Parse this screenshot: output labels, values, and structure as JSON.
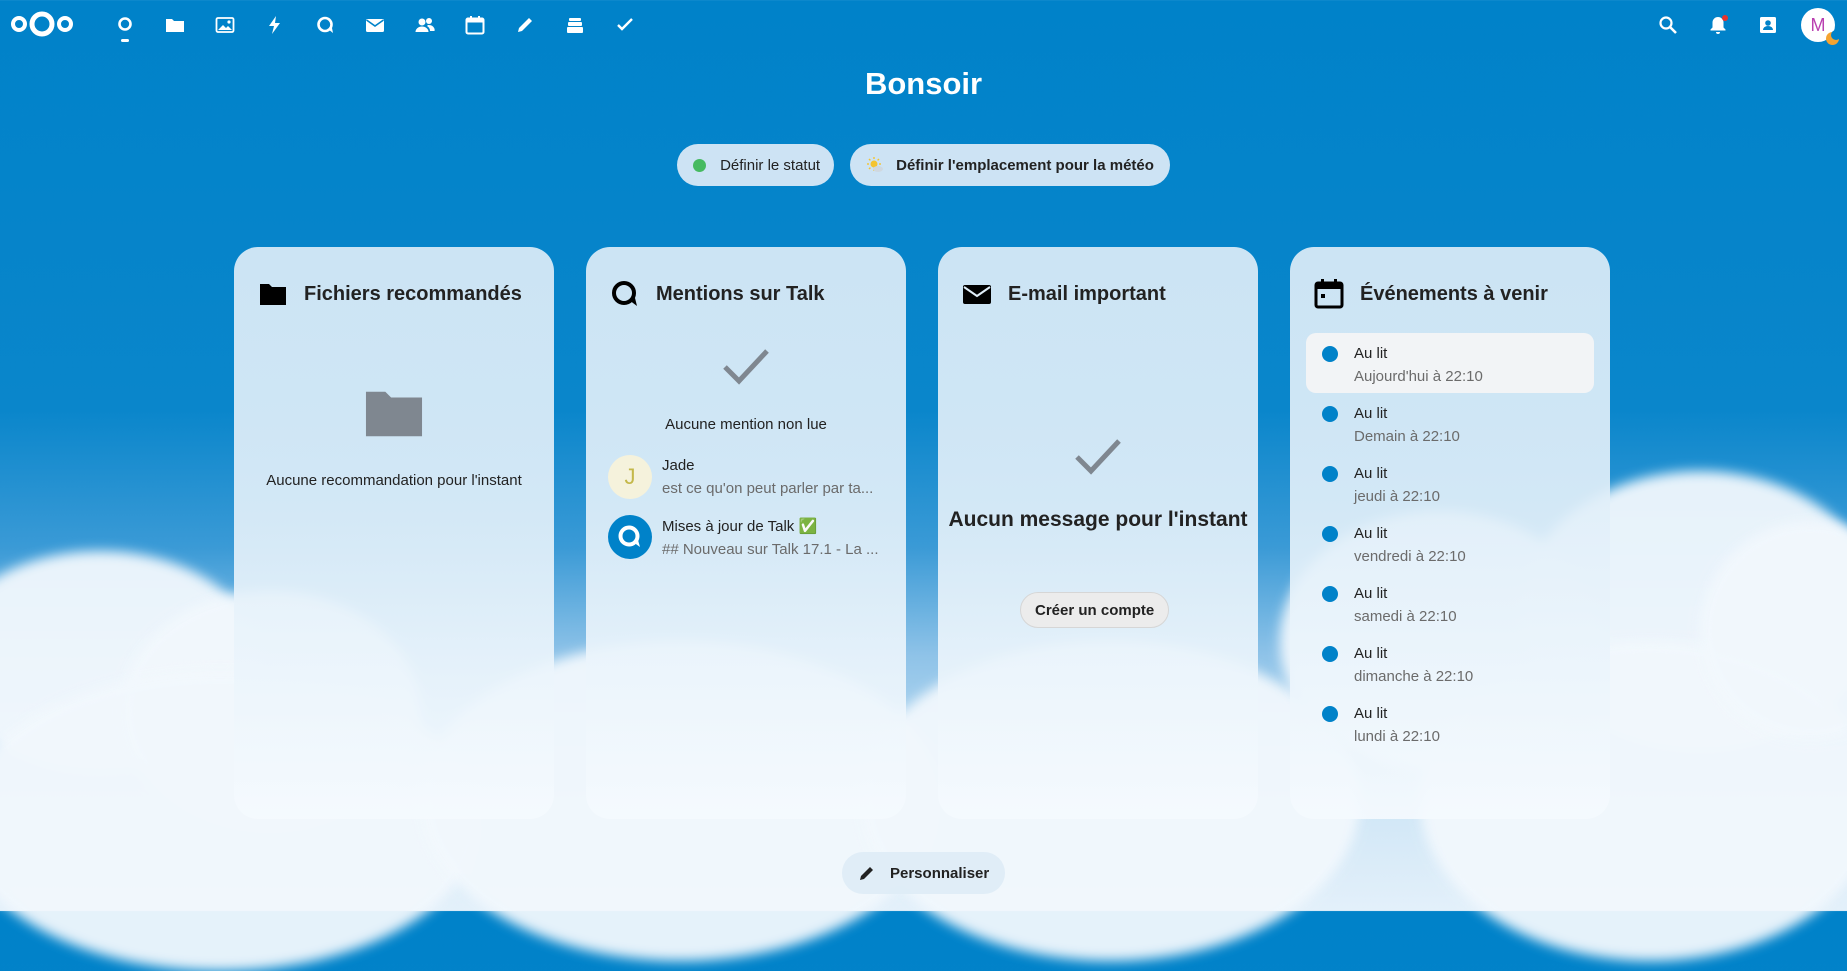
{
  "header": {
    "apps": [
      "Dashboard",
      "Files",
      "Photos",
      "Activity",
      "Talk",
      "Mail",
      "Contacts",
      "Calendar",
      "Notes",
      "Deck",
      "Tasks"
    ],
    "avatar_initial": "M"
  },
  "greeting": "Bonsoir",
  "status_button": "Définir le statut",
  "weather_button": "Définir l'emplacement pour la météo",
  "panels": {
    "files": {
      "title": "Fichiers recommandés",
      "empty_text": "Aucune recommandation pour l'instant"
    },
    "talk": {
      "title": "Mentions sur Talk",
      "empty_text": "Aucune mention non lue",
      "items": [
        {
          "initial": "J",
          "name": "Jade",
          "sub": "est ce qu'on peut parler par ta..."
        },
        {
          "name": "Mises à jour de Talk ✅",
          "sub": "## Nouveau sur Talk 17.1 - La ..."
        }
      ]
    },
    "mail": {
      "title": "E-mail important",
      "empty_text": "Aucun message pour l'instant",
      "button": "Créer un compte"
    },
    "events": {
      "title": "Événements à venir",
      "items": [
        {
          "title": "Au lit",
          "time": "Aujourd'hui à 22:10"
        },
        {
          "title": "Au lit",
          "time": "Demain à 22:10"
        },
        {
          "title": "Au lit",
          "time": "jeudi à 22:10"
        },
        {
          "title": "Au lit",
          "time": "vendredi à 22:10"
        },
        {
          "title": "Au lit",
          "time": "samedi à 22:10"
        },
        {
          "title": "Au lit",
          "time": "dimanche à 22:10"
        },
        {
          "title": "Au lit",
          "time": "lundi à 22:10"
        }
      ]
    }
  },
  "customize_button": "Personnaliser",
  "colors": {
    "primary": "#0082c9",
    "status_online": "#46ba61",
    "event_dot": "#0082c9"
  }
}
